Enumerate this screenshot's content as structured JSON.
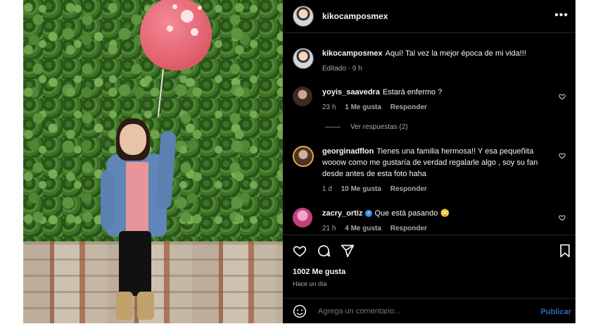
{
  "post": {
    "username": "kikocamposmex",
    "caption": "Aquí! Tal vez la mejor época de mi vida!!!",
    "caption_meta": "Editado · 9 h",
    "more_icon": "more-horizontal-icon"
  },
  "comments": [
    {
      "user": "yoyis_saavedra",
      "text": "Estará enfermo ?",
      "time": "23 h",
      "likes": "1 Me gusta",
      "reply": "Responder"
    },
    {
      "user": "georginadflon",
      "text": "Tienes una familia hermosa!! Y esa pequeñita wooow como me gustaría de verdad regalarle algo , soy su fan desde antes de esta foto haha",
      "time": "1 d",
      "likes": "10 Me gusta",
      "reply": "Responder"
    },
    {
      "user": "zacry_ortiz",
      "text": "Que está pasando 😳",
      "time": "21 h",
      "likes": "4 Me gusta",
      "reply": "Responder"
    }
  ],
  "view_replies": "Ver respuestas (2)",
  "actions": {
    "like_icon": "heart-icon",
    "comment_icon": "comment-icon",
    "share_icon": "send-icon",
    "save_icon": "bookmark-icon"
  },
  "likes_count": "1002 Me gusta",
  "posted_ago": "Hace un día",
  "composer": {
    "placeholder": "Agrega un comentario...",
    "publish": "Publicar",
    "emoji_icon": "emoji-icon"
  },
  "colors": {
    "background": "#000000",
    "publish_link": "#2a6db8",
    "verified": "#3797f0"
  }
}
